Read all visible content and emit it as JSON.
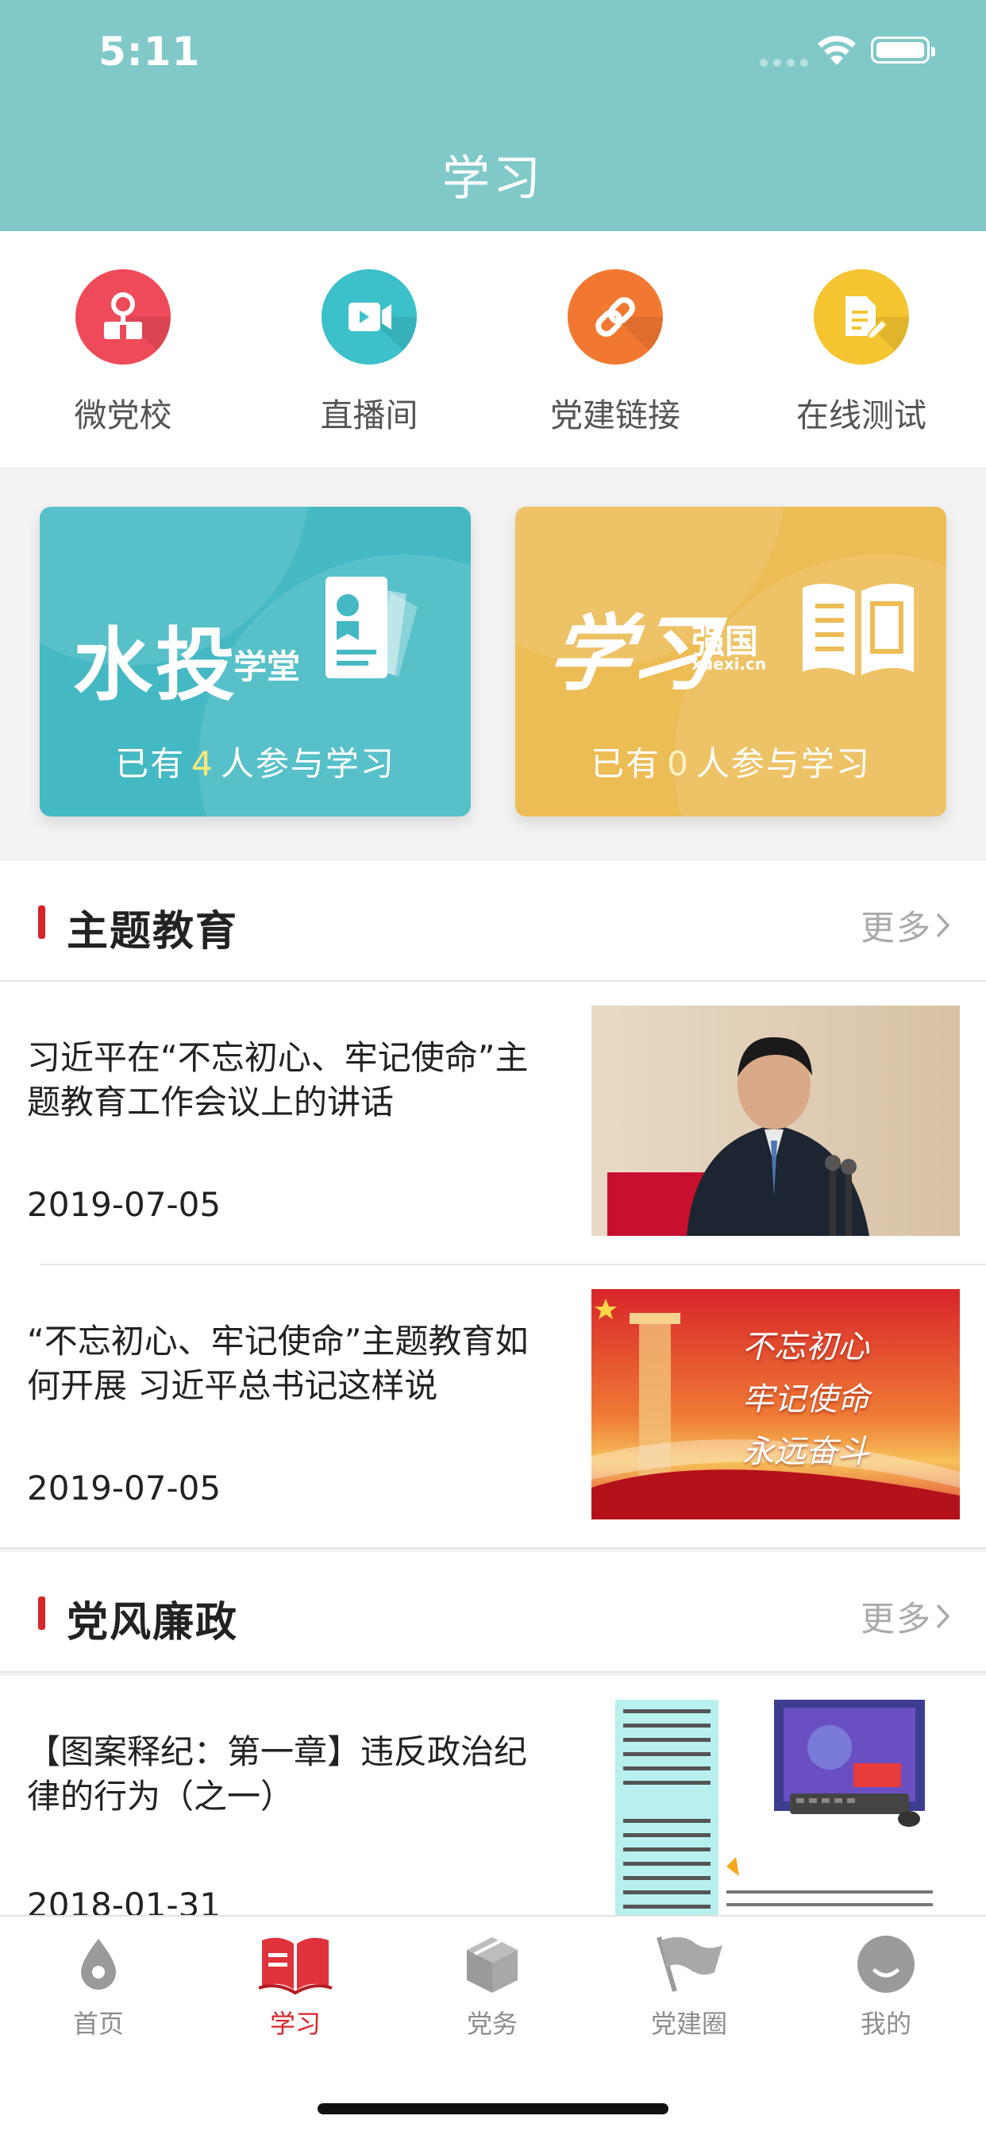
{
  "status_bar": {
    "time": "5:11"
  },
  "nav": {
    "title": "学习"
  },
  "quick_links": [
    {
      "label": "微党校",
      "icon": "podium-icon",
      "color": "#ef4a5a"
    },
    {
      "label": "直播间",
      "icon": "video-camera-icon",
      "color": "#3cc0c9"
    },
    {
      "label": "党建链接",
      "icon": "link-icon",
      "color": "#f27832"
    },
    {
      "label": "在线测试",
      "icon": "document-edit-icon",
      "color": "#f4c530"
    }
  ],
  "cards": [
    {
      "logo_main": "水投",
      "logo_sub": "学堂",
      "prefix": "已有",
      "count": "4",
      "suffix": "人参与学习",
      "color": "#45b9c3"
    },
    {
      "logo_main": "学习",
      "logo_sub": "强国",
      "logo_url": "xuexi.cn",
      "prefix": "已有",
      "count": "0",
      "suffix": "人参与学习",
      "color": "#ecbc55"
    }
  ],
  "sections": [
    {
      "title": "主题教育",
      "more": "更多",
      "articles": [
        {
          "title": "习近平在“不忘初心、牢记使命”主题教育工作会议上的讲话",
          "date": "2019-07-05",
          "image": "photo-speaker"
        },
        {
          "title": "“不忘初心、牢记使命”主题教育如何开展 习近平总书记这样说",
          "date": "2019-07-05",
          "image": "poster-red",
          "image_text": [
            "不忘初心",
            "牢记使命",
            "永远奋斗"
          ]
        }
      ]
    },
    {
      "title": "党风廉政",
      "more": "更多",
      "articles": [
        {
          "title": "【图案释纪：第一章】违反政治纪律的行为（之一）",
          "date": "2018-01-31",
          "image": "cartoon-illustration"
        }
      ]
    }
  ],
  "tabbar": [
    {
      "label": "首页",
      "icon": "drop-icon",
      "active": false
    },
    {
      "label": "学习",
      "icon": "book-icon",
      "active": true
    },
    {
      "label": "党务",
      "icon": "box-icon",
      "active": false
    },
    {
      "label": "党建圈",
      "icon": "flag-icon",
      "active": false
    },
    {
      "label": "我的",
      "icon": "smile-icon",
      "active": false
    }
  ],
  "colors": {
    "header": "#80c9c8",
    "accent": "#d6252a",
    "tab_inactive": "#8d8d8d"
  }
}
